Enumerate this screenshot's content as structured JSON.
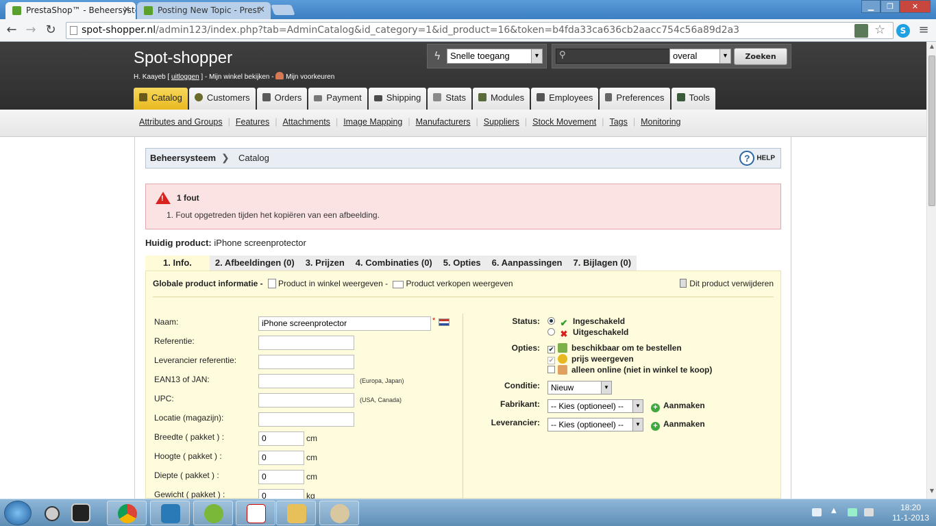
{
  "browser": {
    "tabs": [
      {
        "title": "PrestaShop™ - Beheersyste",
        "active": true
      },
      {
        "title": "Posting New Topic - Prest",
        "active": false
      }
    ],
    "url_host": "spot-shopper.nl",
    "url_path": "/admin123/index.php?tab=AdminCatalog&id_category=1&id_product=16&token=b4fda33ca636cb2aacc754c56a89d2a3"
  },
  "header": {
    "shop_title": "Spot-shopper",
    "user_name": "H. Kaayeb [",
    "logout": "uitloggen",
    "user_rest": "] - Mijn winkel bekijken -",
    "preferences": "Mijn voorkeuren",
    "quick_access": "Snelle toegang",
    "search_scope": "overal",
    "search_button": "Zoeken"
  },
  "main_tabs": [
    "Catalog",
    "Customers",
    "Orders",
    "Payment",
    "Shipping",
    "Stats",
    "Modules",
    "Employees",
    "Preferences",
    "Tools"
  ],
  "subnav": [
    "Attributes and Groups",
    "Features",
    "Attachments",
    "Image Mapping",
    "Manufacturers",
    "Suppliers",
    "Stock Movement",
    "Tags",
    "Monitoring"
  ],
  "breadcrumb": {
    "root": "Beheersysteem",
    "current": "Catalog",
    "help": "HELP"
  },
  "error": {
    "title": "1 fout",
    "message": "1.   Fout opgetreden tijden het kopiëren van een afbeelding."
  },
  "current_product": {
    "label": "Huidig product:",
    "name": "iPhone screenprotector"
  },
  "product_tabs": [
    "1. Info.",
    "2. Afbeeldingen (0)",
    "3. Prijzen",
    "4. Combinaties (0)",
    "5. Opties",
    "6. Aanpassingen",
    "7. Bijlagen (0)"
  ],
  "panel": {
    "heading": "Globale product informatie -",
    "view_in_shop": "Product in winkel weergeven -",
    "sell_view": "Product verkopen weergeven",
    "delete": "Dit product verwijderen"
  },
  "form": {
    "name_label": "Naam:",
    "name_value": "iPhone screenprotector",
    "reference_label": "Referentie:",
    "supplier_ref_label": "Leverancier referentie:",
    "ean_label": "EAN13 of JAN:",
    "ean_hint": "(Europa, Japan)",
    "upc_label": "UPC:",
    "upc_hint": "(USA, Canada)",
    "location_label": "Locatie (magazijn):",
    "width_label": "Breedte ( pakket ) :",
    "width_value": "0",
    "width_unit": "cm",
    "height_label": "Hoogte ( pakket ) :",
    "height_value": "0",
    "height_unit": "cm",
    "depth_label": "Diepte ( pakket ) :",
    "depth_value": "0",
    "depth_unit": "cm",
    "weight_label": "Gewicht ( pakket ) :",
    "weight_value": "0",
    "weight_unit": "kg"
  },
  "right_form": {
    "status_label": "Status:",
    "enabled": "Ingeschakeld",
    "disabled": "Uitgeschakeld",
    "options_label": "Opties:",
    "opt_available": "beschikbaar om te bestellen",
    "opt_show_price": "prijs weergeven",
    "opt_online_only": "alleen online (niet in winkel te koop)",
    "condition_label": "Conditie:",
    "condition_value": "Nieuw",
    "manufacturer_label": "Fabrikant:",
    "manufacturer_value": "-- Kies (optioneel) --",
    "supplier_label": "Leverancier:",
    "supplier_value": "-- Kies (optioneel) --",
    "create": "Aanmaken"
  },
  "taskbar": {
    "time": "18:20",
    "date": "11-1-2013"
  }
}
